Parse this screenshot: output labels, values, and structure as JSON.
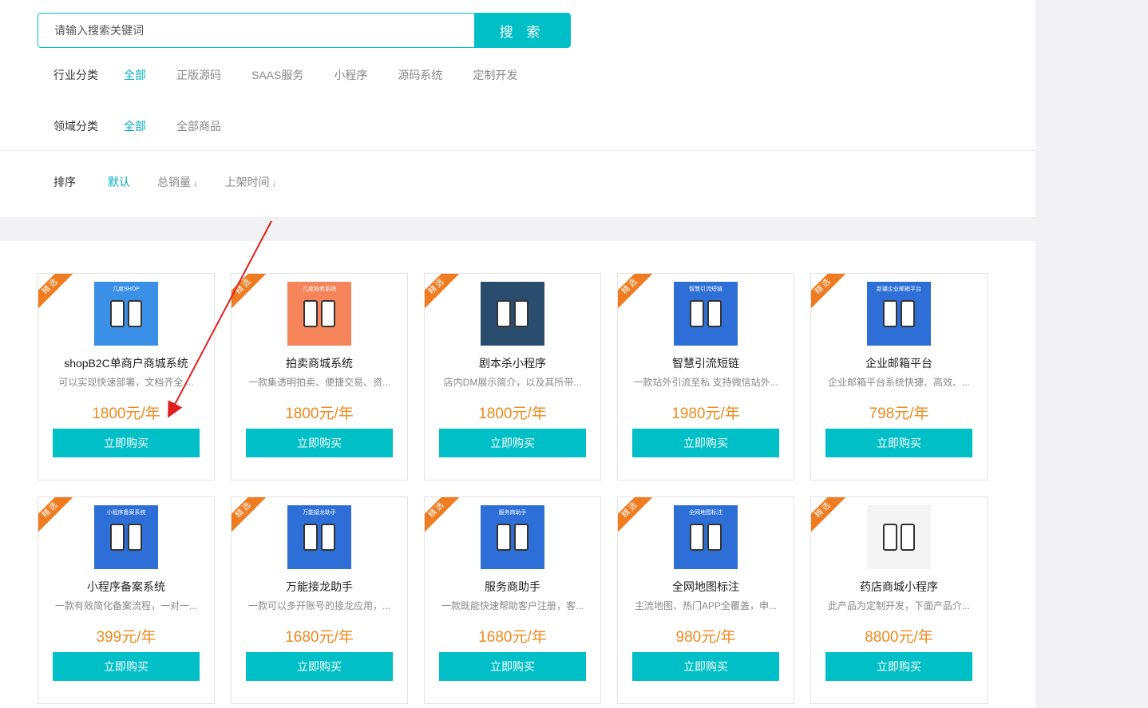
{
  "search": {
    "placeholder": "请输入搜索关键词",
    "button_label": "搜 索"
  },
  "industry": {
    "label": "行业分类",
    "options": [
      "全部",
      "正版源码",
      "SAAS服务",
      "小程序",
      "源码系统",
      "定制开发"
    ],
    "active": "全部"
  },
  "domain": {
    "label": "领域分类",
    "options": [
      "全部",
      "全部商品"
    ],
    "active": "全部"
  },
  "sort": {
    "label": "排序",
    "options": [
      "默认",
      "总销量",
      "上架时间"
    ],
    "active": "默认",
    "arrow_glyph": "↓"
  },
  "badge_text": "精选",
  "buy_label": "立即购买",
  "products": [
    {
      "name": "shopB2C单商户商城系统",
      "desc": "可以实现快速部署，文档齐全,...",
      "price": "1800元/年",
      "thumb_color": "#3a8fe6",
      "thumb_text": "几度SHOP"
    },
    {
      "name": "拍卖商城系统",
      "desc": "一款集透明拍卖、便捷交易、资...",
      "price": "1800元/年",
      "thumb_color": "#f5845a",
      "thumb_text": "几度拍卖系统"
    },
    {
      "name": "剧本杀小程序",
      "desc": "店内DM展示简介，以及其所带...",
      "price": "1800元/年",
      "thumb_color": "#2a4d6e",
      "thumb_text": ""
    },
    {
      "name": "智慧引流短链",
      "desc": "一款站外引流至私 支持微信站外...",
      "price": "1980元/年",
      "thumb_color": "#2d6fd6",
      "thumb_text": "智慧引流短链"
    },
    {
      "name": "企业邮箱平台",
      "desc": "企业邮箱平台系统快捷、高效、...",
      "price": "798元/年",
      "thumb_color": "#2d6fd6",
      "thumb_text": "新疆企业邮箱平台"
    },
    {
      "name": "小程序备案系统",
      "desc": "一款有效简化备案流程，一对一...",
      "price": "399元/年",
      "thumb_color": "#2d6fd6",
      "thumb_text": "小程序备案系统"
    },
    {
      "name": "万能接龙助手",
      "desc": "一款可以多开账号的接龙应用，...",
      "price": "1680元/年",
      "thumb_color": "#2d6fd6",
      "thumb_text": "万能接龙助手"
    },
    {
      "name": "服务商助手",
      "desc": "一款既能快速帮助客户注册，客...",
      "price": "1680元/年",
      "thumb_color": "#2d6fd6",
      "thumb_text": "服务商助手"
    },
    {
      "name": "全网地图标注",
      "desc": "主流地图、热门APP全覆盖，申...",
      "price": "980元/年",
      "thumb_color": "#2d6fd6",
      "thumb_text": "全网地图标注"
    },
    {
      "name": "药店商城小程序",
      "desc": "此产品为定制开发，下面产品介...",
      "price": "8800元/年",
      "thumb_color": "#f4f4f4",
      "thumb_text": ""
    }
  ],
  "colors": {
    "accent": "#00bfc6",
    "price": "#ef8a1e",
    "ribbon": "#f07c21",
    "annotation": "#e02020"
  }
}
